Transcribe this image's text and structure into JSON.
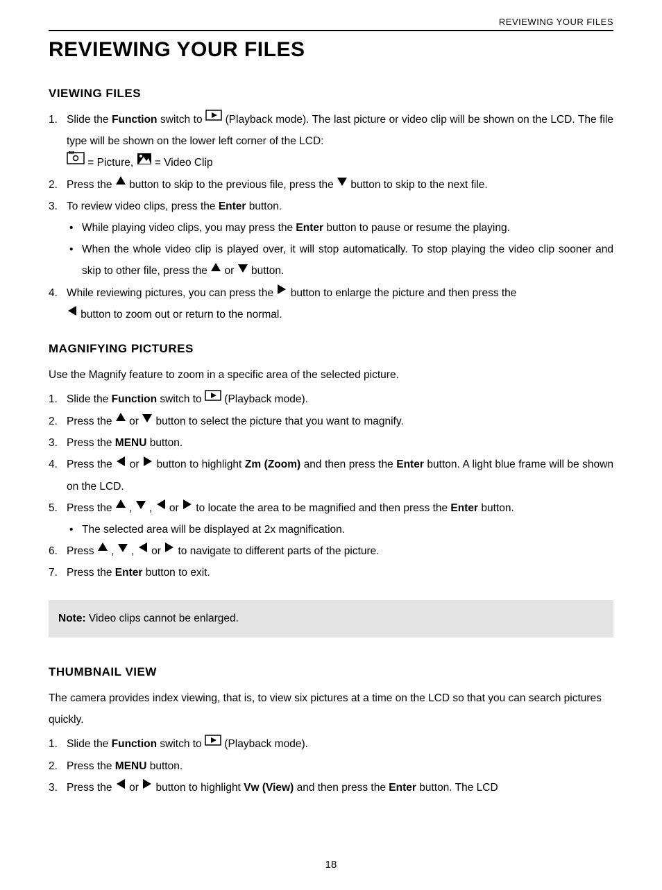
{
  "running_header": "REVIEWING YOUR FILES",
  "main_title": "REVIEWING YOUR FILES",
  "page_number": "18",
  "viewing_files": {
    "title": "VIEWING FILES",
    "items": {
      "i1a": "Slide the ",
      "i1_function": "Function",
      "i1b": " switch to ",
      "i1c": " (Playback mode). The last picture or video clip will be shown on the LCD. The file type will be shown on the lower left corner of the LCD:",
      "i1_pic_label": " = Picture,  ",
      "i1_vid_label": " = Video Clip",
      "i2a": "Press the ",
      "i2b": " button to skip to the previous file, press the ",
      "i2c": " button to skip to the next file.",
      "i3a": "To review video clips, press the ",
      "i3_enter": "Enter",
      "i3b": " button.",
      "i3_b1a": "While playing video clips, you may press the ",
      "i3_b1_enter": "Enter",
      "i3_b1b": " button to pause or resume the playing.",
      "i3_b2a": "When the whole video clip is played over, it will stop automatically. To stop playing the video clip sooner and skip to other file, press the ",
      "i3_b2b": " or ",
      "i3_b2c": " button.",
      "i4a": "While reviewing pictures, you can press the ",
      "i4b": " button to enlarge the picture and then press the ",
      "i4c": " button to zoom out or return to the normal."
    }
  },
  "magnifying": {
    "title": "MAGNIFYING PICTURES",
    "intro": "Use the Magnify feature to zoom in a specific area of the selected picture.",
    "items": {
      "i1a": "Slide the ",
      "i1_function": "Function",
      "i1b": " switch to ",
      "i1c": " (Playback mode).",
      "i2a": "Press the ",
      "i2b": " or ",
      "i2c": " button to select the picture that you want to magnify.",
      "i3a": "Press the ",
      "i3_menu": "MENU",
      "i3b": " button.",
      "i4a": "Press the ",
      "i4b": " or ",
      "i4c": " button to highlight ",
      "i4_zm": "Zm (Zoom)",
      "i4d": " and then press the ",
      "i4_enter": "Enter",
      "i4e": " button. A light blue frame will be shown on the LCD.",
      "i5a": "Press the  ",
      "i5b": " ,  ",
      "i5c": " ,  ",
      "i5d": " or ",
      "i5e": " to locate the area to be magnified and then press the ",
      "i5_enter": "Enter",
      "i5f": " button.",
      "i5_bullet": "The selected area will be displayed at 2x magnification.",
      "i6a": "Press ",
      "i6b": " ,  ",
      "i6c": " ,  ",
      "i6d": " or ",
      "i6e": " to navigate to different parts of the picture.",
      "i7a": "Press the ",
      "i7_enter": "Enter",
      "i7b": " button to exit."
    },
    "note_label": "Note:",
    "note_text": " Video clips cannot be enlarged."
  },
  "thumbnail": {
    "title": "THUMBNAIL VIEW",
    "intro": "The camera provides index viewing, that is, to view six pictures at a time on the LCD so that you can search pictures quickly.",
    "items": {
      "i1a": "Slide the ",
      "i1_function": "Function",
      "i1b": " switch to ",
      "i1c": " (Playback mode).",
      "i2a": "Press the ",
      "i2_menu": "MENU",
      "i2b": " button.",
      "i3a": "Press the ",
      "i3b": " or ",
      "i3c": " button to highlight ",
      "i3_vw": "Vw (View)",
      "i3d": " and then press the ",
      "i3_enter": "Enter",
      "i3e": " button. The LCD"
    }
  }
}
